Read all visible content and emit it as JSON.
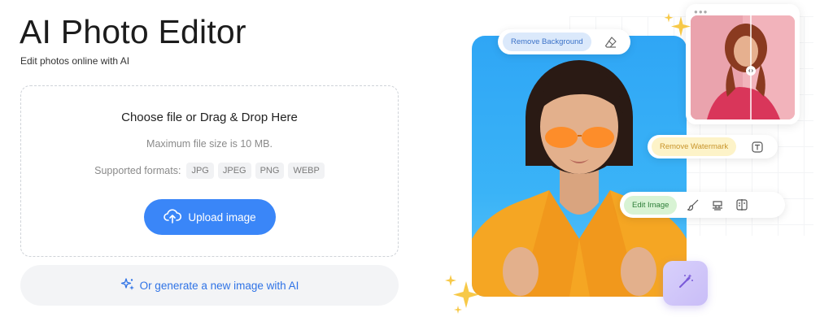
{
  "header": {
    "title": "AI Photo Editor",
    "subtitle": "Edit photos online with AI"
  },
  "dropzone": {
    "heading": "Choose file or Drag & Drop Here",
    "max_size": "Maximum file size is 10 MB.",
    "formats_label": "Supported formats:",
    "formats": [
      "JPG",
      "JPEG",
      "PNG",
      "WEBP"
    ],
    "upload_label": "Upload image",
    "upload_icon": "upload-cloud-icon"
  },
  "generate": {
    "label": "Or generate a new image with AI",
    "icon": "sparkles-icon"
  },
  "hero": {
    "chips": {
      "remove_background": "Remove Background",
      "remove_watermark": "Remove Watermark",
      "edit_image": "Edit Image"
    },
    "icons": [
      "eraser-icon",
      "text-icon",
      "brush-icon",
      "stamp-icon",
      "compare-icon",
      "magic-wand-icon"
    ]
  },
  "colors": {
    "accent": "#3a86f8",
    "link": "#2f73e6",
    "photo_bg": "#2fa6f5",
    "chip_blue": "#dbe9fb",
    "chip_yellow": "#fdf3c8",
    "chip_green": "#d8f3d4",
    "magic_bg": "#d8d0fb",
    "sparkle": "#f7c948"
  }
}
